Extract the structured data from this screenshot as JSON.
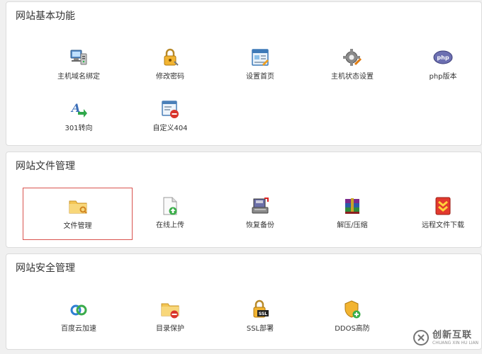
{
  "sections": [
    {
      "title": "网站基本功能",
      "items": [
        {
          "label": "主机域名绑定",
          "icon": "server-icon"
        },
        {
          "label": "修改密码",
          "icon": "lock-icon"
        },
        {
          "label": "设置首页",
          "icon": "homepage-icon"
        },
        {
          "label": "主机状态设置",
          "icon": "gear-icon"
        },
        {
          "label": "php版本",
          "icon": "php-icon"
        },
        {
          "label": "301转向",
          "icon": "redirect-icon"
        },
        {
          "label": "自定义404",
          "icon": "error-page-icon"
        }
      ]
    },
    {
      "title": "网站文件管理",
      "items": [
        {
          "label": "文件管理",
          "icon": "folder-icon"
        },
        {
          "label": "在线上传",
          "icon": "upload-icon"
        },
        {
          "label": "恢复备份",
          "icon": "backup-icon"
        },
        {
          "label": "解压/压缩",
          "icon": "archive-icon"
        },
        {
          "label": "远程文件下载",
          "icon": "download-icon"
        }
      ]
    },
    {
      "title": "网站安全管理",
      "items": [
        {
          "label": "百度云加速",
          "icon": "cloud-icon"
        },
        {
          "label": "目录保护",
          "icon": "folder-protect-icon"
        },
        {
          "label": "SSL部署",
          "icon": "ssl-icon"
        },
        {
          "label": "DDOS高防",
          "icon": "shield-icon"
        }
      ]
    }
  ],
  "watermark": {
    "text": "创新互联",
    "sub": "CHUANG XIN HU LIAN"
  }
}
